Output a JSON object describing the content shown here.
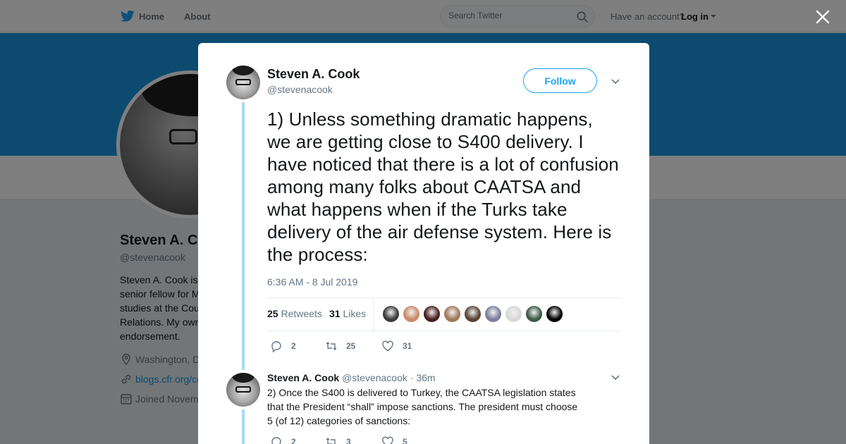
{
  "nav": {
    "home": "Home",
    "about": "About",
    "search_placeholder": "Search Twitter",
    "have_account": "Have an account?",
    "login": "Log in"
  },
  "profile": {
    "name": "Steven A. C",
    "handle": "@stevenacook",
    "bio": "Steven A. Cook is senior fellow for M studies at the Cou Relations. My own endorsement.",
    "location": "Washington, D",
    "website": "blogs.cfr.org/co",
    "joined": "Joined Novem"
  },
  "tweet": {
    "author_name": "Steven A. Cook",
    "author_handle": "@stevenacook",
    "follow_label": "Follow",
    "text": "1) Unless something dramatic happens, we are getting close to S400 delivery. I have noticed that there is a lot of confusion among many folks about CAATSA and what happens when if the Turks take delivery of the air defense system.  Here is the process:",
    "time": "6:36 AM - 8 Jul 2019",
    "retweets_count": "25",
    "retweets_label": "Retweets",
    "likes_count": "31",
    "likes_label": "Likes",
    "replies": "2",
    "retweets": "25",
    "likes": "31",
    "liker_colors": [
      "#3b3b3b",
      "#c98b6a",
      "#4a1f1f",
      "#a07a5a",
      "#5a4636",
      "#7b7f9c",
      "#d8d8d8",
      "#3e5a46",
      "#000000"
    ]
  },
  "reply": {
    "author_name": "Steven A. Cook",
    "author_handle": "@stevenacook",
    "time": "· 36m",
    "text": "2) Once the S400 is delivered to Turkey, the CAATSA legislation states that the President “shall” impose sanctions.  The president must choose 5 (of 12) categories of sanctions:",
    "replies": "2",
    "retweets": "3",
    "likes": "5"
  },
  "colors": {
    "banner": "#1b95e0",
    "accent": "#1da1f2",
    "thread_line": "#a8d9f9"
  }
}
